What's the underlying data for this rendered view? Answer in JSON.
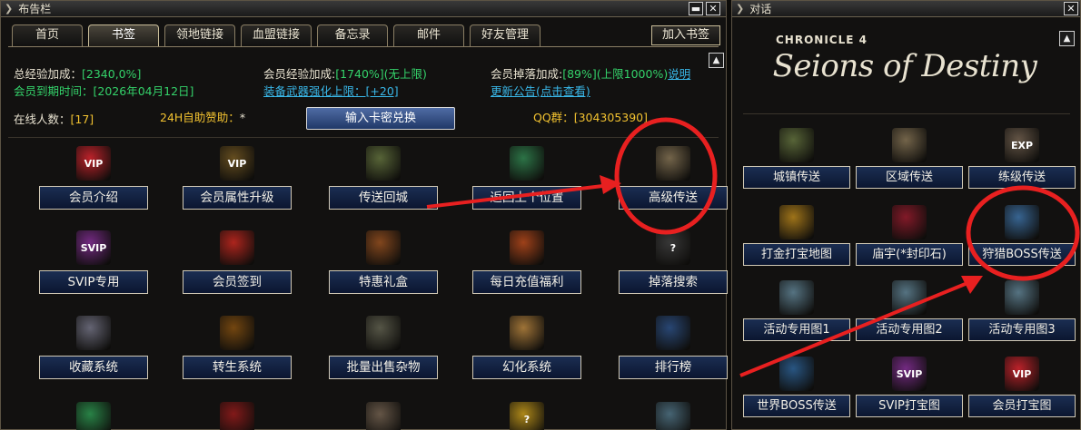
{
  "left_panel": {
    "title": "布告栏",
    "tabs": [
      "首页",
      "书签",
      "领地链接",
      "血盟链接",
      "备忘录",
      "邮件",
      "好友管理"
    ],
    "active_tab": 1,
    "add_bookmark": "加入书签",
    "info": {
      "exp_bonus_label": "总经验加成：",
      "exp_bonus_value": "[2340,0%]",
      "vip_exp_label": "会员经验加成:",
      "vip_exp_value": "[1740%](无上限)",
      "vip_drop_label": "会员掉落加成:",
      "vip_drop_value": "[89%](上限1000%)",
      "explain_link": "说明",
      "expire_label": "会员到期时间：",
      "expire_value": "[2026年04月12日]",
      "equip_limit_label": "装备武器强化上限：",
      "equip_limit_value": "[+20]",
      "announcement_link": "更新公告(点击查看)",
      "online_label": "在线人数：",
      "online_value": "[17]",
      "sponsor_label": "24H自助赞助：",
      "sponsor_value": "*",
      "card_button": "输入卡密兑换",
      "qq_label": "QQ群：",
      "qq_value": "[304305390]"
    },
    "items": [
      {
        "label": "会员介绍",
        "icon": "vip-badge-icon",
        "icon_text": "VIP",
        "color": "#c8232c"
      },
      {
        "label": "会员属性升级",
        "icon": "vip-star-icon",
        "icon_text": "VIP",
        "color": "#6a5120"
      },
      {
        "label": "传送回城",
        "icon": "map-icon",
        "icon_text": "",
        "color": "#5c6a3a"
      },
      {
        "label": "返回上个位置",
        "icon": "recycle-icon",
        "icon_text": "",
        "color": "#2e7a4a"
      },
      {
        "label": "高级传送",
        "icon": "scroll-icon",
        "icon_text": "",
        "color": "#7a6a4e"
      },
      {
        "label": "SVIP专用",
        "icon": "svip-badge-icon",
        "icon_text": "SVIP",
        "color": "#7a2c8a"
      },
      {
        "label": "会员签到",
        "icon": "crown-icon",
        "icon_text": "",
        "color": "#b8261e"
      },
      {
        "label": "特惠礼盒",
        "icon": "treasure-chest-icon",
        "icon_text": "",
        "color": "#8a4a1e"
      },
      {
        "label": "每日充值福利",
        "icon": "coin-stack-icon",
        "icon_text": "",
        "color": "#a8441a"
      },
      {
        "label": "掉落搜索",
        "icon": "drop-search-icon",
        "icon_text": "?",
        "color": "#3a3a3a"
      },
      {
        "label": "收藏系统",
        "icon": "collection-bag-icon",
        "icon_text": "",
        "color": "#6a6a7a"
      },
      {
        "label": "转生系统",
        "icon": "rebirth-emblem-icon",
        "icon_text": "",
        "color": "#7a4a10"
      },
      {
        "label": "批量出售杂物",
        "icon": "mortar-icon",
        "icon_text": "",
        "color": "#5a5a4a"
      },
      {
        "label": "幻化系统",
        "icon": "character-face-icon",
        "icon_text": "",
        "color": "#a87a3a"
      },
      {
        "label": "排行榜",
        "icon": "people-icon",
        "icon_text": "",
        "color": "#2a4a7a"
      },
      {
        "label": "",
        "icon": "green-crystal-icon",
        "icon_text": "",
        "color": "#2a8a4a"
      },
      {
        "label": "",
        "icon": "red-banner-icon",
        "icon_text": "",
        "color": "#8a1a1a"
      },
      {
        "label": "",
        "icon": "gear-emblem-icon",
        "icon_text": "",
        "color": "#6a5a4a"
      },
      {
        "label": "",
        "icon": "question-scroll-icon",
        "icon_text": "?",
        "color": "#b8901a"
      },
      {
        "label": "",
        "icon": "creature-icon",
        "icon_text": "",
        "color": "#4a6a7a"
      }
    ]
  },
  "right_panel": {
    "title": "对话",
    "logo_small": "CHRONICLE 4",
    "logo_big": "Seions of Destiny",
    "items": [
      {
        "label": "城镇传送",
        "icon": "map-icon",
        "icon_text": "",
        "color": "#5c6a3a"
      },
      {
        "label": "区域传送",
        "icon": "scroll-icon",
        "icon_text": "",
        "color": "#7a6a4e"
      },
      {
        "label": "练级传送",
        "icon": "exp-icon",
        "icon_text": "EXP",
        "color": "#6a5a4a"
      },
      {
        "label": "打金打宝地图",
        "icon": "gold-bag-icon",
        "icon_text": "",
        "color": "#a87a1a"
      },
      {
        "label": "庙宇(*封印石)",
        "icon": "red-stone-icon",
        "icon_text": "",
        "color": "#8a1a2a"
      },
      {
        "label": "狩猎BOSS传送",
        "icon": "blue-scroll-icon",
        "icon_text": "",
        "color": "#3a6a9a"
      },
      {
        "label": "活动专用图1",
        "icon": "quill-scroll-icon",
        "icon_text": "",
        "color": "#5a7a8a"
      },
      {
        "label": "活动专用图2",
        "icon": "quill-scroll-icon",
        "icon_text": "",
        "color": "#5a7a8a"
      },
      {
        "label": "活动专用图3",
        "icon": "quill-scroll-icon",
        "icon_text": "",
        "color": "#5a7a8a"
      },
      {
        "label": "世界BOSS传送",
        "icon": "crystal-crown-icon",
        "icon_text": "",
        "color": "#2a5a8a"
      },
      {
        "label": "SVIP打宝图",
        "icon": "svip-badge-icon",
        "icon_text": "SVIP",
        "color": "#7a2c8a"
      },
      {
        "label": "会员打宝图",
        "icon": "vip-badge-icon",
        "icon_text": "VIP",
        "color": "#c8232c"
      }
    ]
  },
  "colors": {
    "annotation_red": "#e82020",
    "button_blue": "#0b1630",
    "info_green": "#34d26a",
    "info_cyan": "#39b7e8",
    "info_yellow": "#f2c230"
  }
}
